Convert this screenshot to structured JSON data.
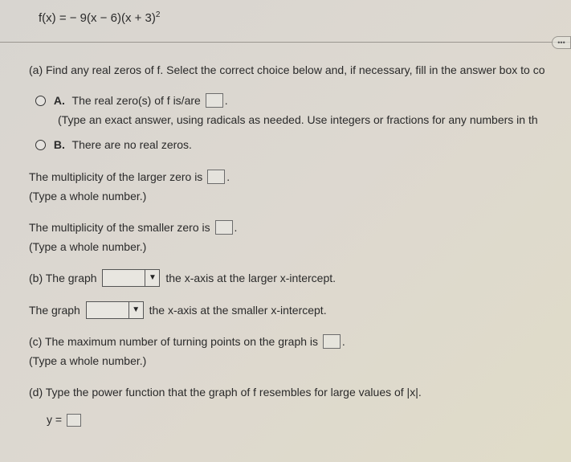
{
  "func_line": "f(x) = − 9(x − 6)(x + 3)",
  "func_exp": "2",
  "parts": {
    "a": {
      "prompt": "(a) Find any real zeros of f. Select the correct choice below and, if necessary, fill in the answer box to co",
      "A": {
        "letter": "A.",
        "line1a": "The real zero(s) of f is/are ",
        "line1b": ".",
        "hint": "(Type an exact answer, using radicals as needed. Use integers or fractions for any numbers in th"
      },
      "B": {
        "letter": "B.",
        "text": "There are no real zeros."
      }
    },
    "mult_larger": {
      "line_a": "The multiplicity of the larger zero is ",
      "line_b": ".",
      "hint": "(Type a whole number.)"
    },
    "mult_smaller": {
      "line_a": "The multiplicity of the smaller zero is ",
      "line_b": ".",
      "hint": "(Type a whole number.)"
    },
    "b": {
      "line1_a": "(b) The graph ",
      "line1_b": " the x-axis at the larger x-intercept.",
      "line2_a": "The graph ",
      "line2_b": " the x-axis at the smaller x-intercept."
    },
    "c": {
      "line_a": "(c) The maximum number of turning points on the graph is ",
      "line_b": ".",
      "hint": "(Type a whole number.)"
    },
    "d": {
      "line": "(d) Type the power function that the graph of f resembles for large values of |x|.",
      "eq": "y = "
    }
  },
  "dropdown_arrow": "▼"
}
